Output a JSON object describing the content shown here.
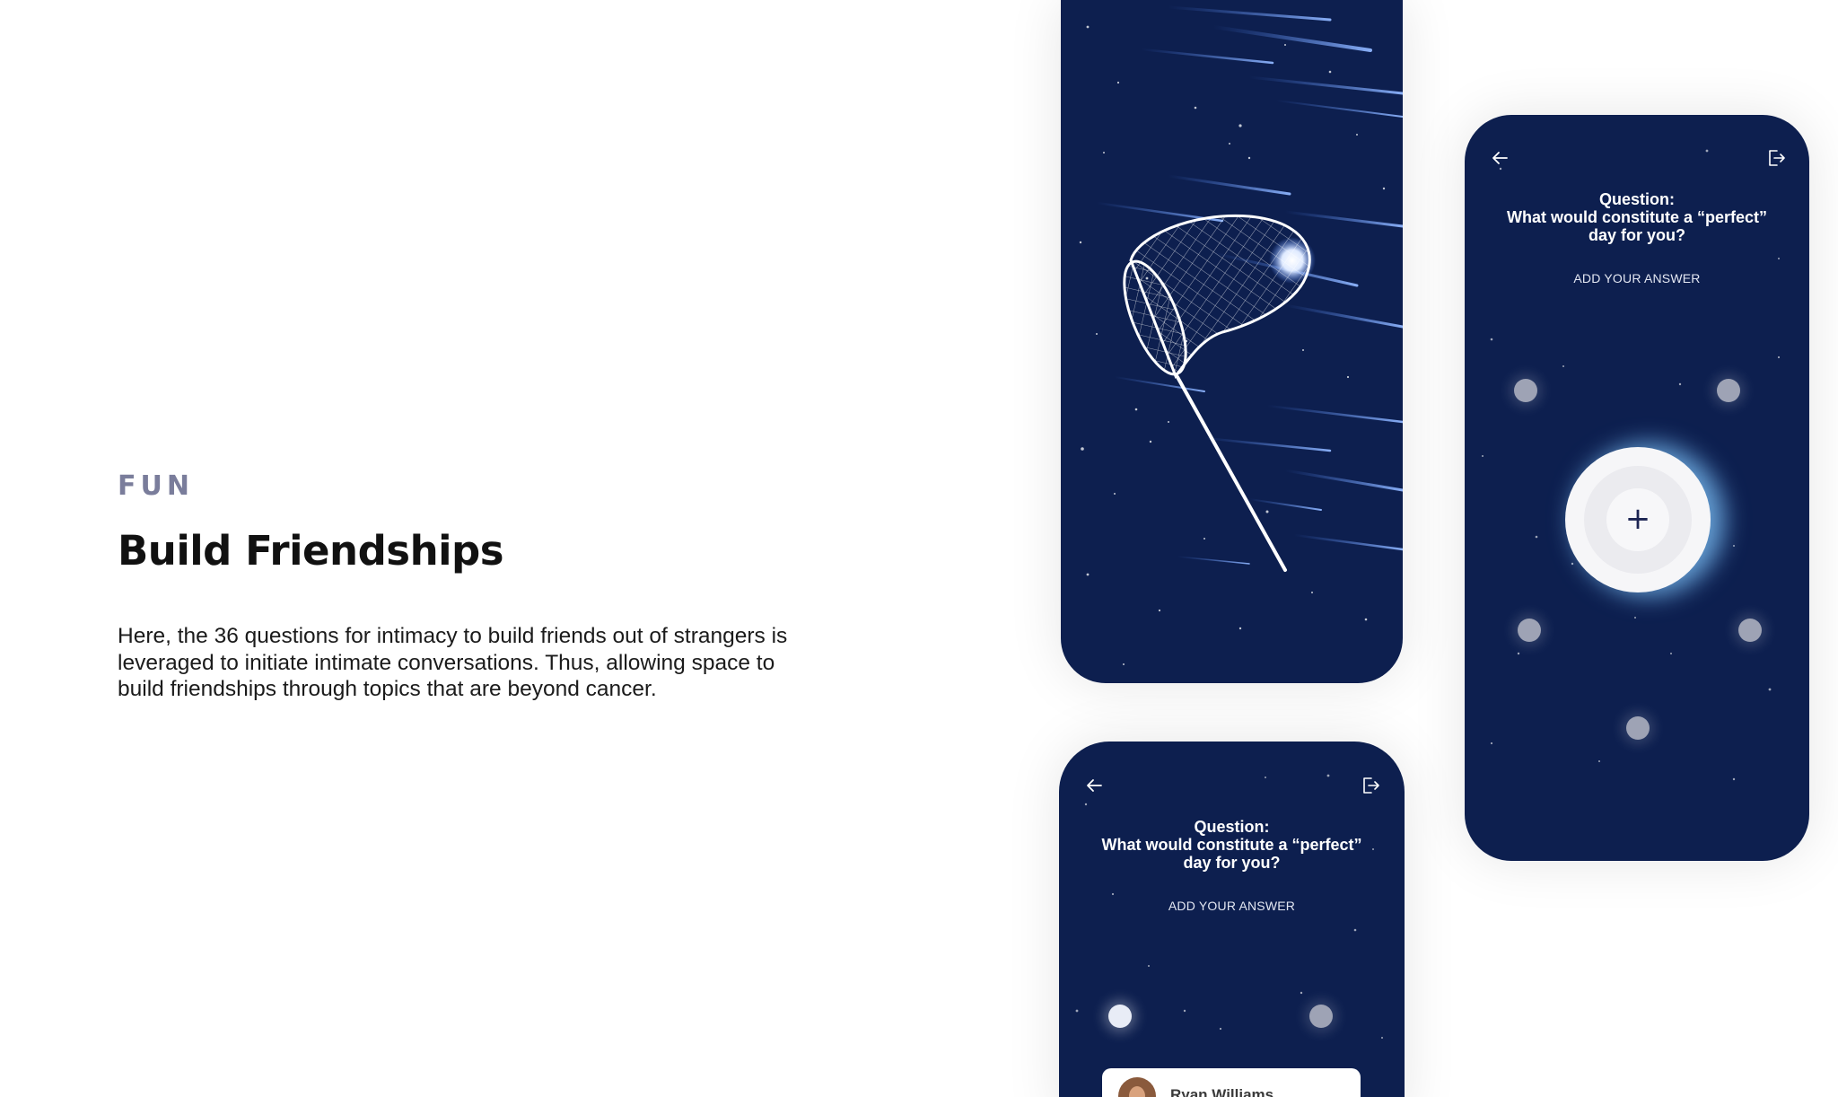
{
  "intro": {
    "eyebrow": "FUN",
    "title": "Build Friendships",
    "description": "Here, the 36 questions for intimacy to build friends out of strangers is leveraged to initiate intimate conversations. Thus, allowing space to build friendships through topics that are beyond cancer."
  },
  "question_screen": {
    "question_label": "Question:",
    "question_line_1": "What would constitute a “perfect”",
    "question_line_2": "day for you?",
    "add_answer": "ADD YOUR ANSWER",
    "add_symbol": "+",
    "participant_name": "Ryan Williams"
  },
  "icons": {
    "back": "arrow-left-icon",
    "exit": "exit-icon",
    "net": "butterfly-net-icon",
    "add": "plus-icon"
  },
  "colors": {
    "screen_background": "#0d1f4f",
    "eyebrow": "#7a7d9b",
    "headline": "#111111",
    "orb_glow": "#82c8ff"
  }
}
